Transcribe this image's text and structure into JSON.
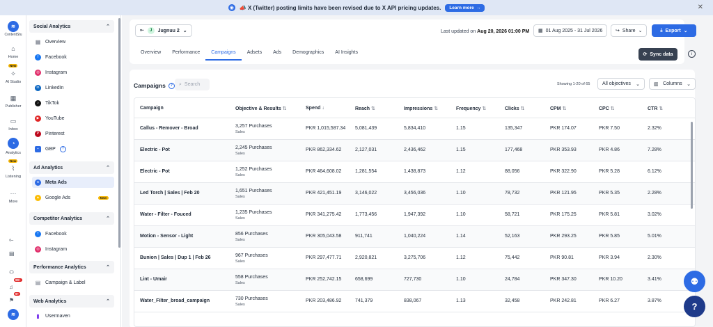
{
  "banner": {
    "message": "📣 X (Twitter) posting limits have been revised due to X API pricing updates.",
    "learn_more": "Learn more",
    "close": "✕"
  },
  "rail": {
    "brand": "ContentStu",
    "items": [
      {
        "label": "Home",
        "icon": "home-icon"
      },
      {
        "label": "AI Studio",
        "icon": "sparkle-icon",
        "tag": "New"
      },
      {
        "label": "Publisher",
        "icon": "calendar-icon"
      },
      {
        "label": "Inbox",
        "icon": "inbox-icon"
      },
      {
        "label": "Analytics",
        "icon": "analytics-icon"
      },
      {
        "label": "Listening",
        "icon": "listening-icon",
        "tag": "New"
      },
      {
        "label": "More",
        "icon": "more-icon"
      }
    ],
    "badges": [
      "99+",
      "9+"
    ]
  },
  "sidebar": {
    "social": {
      "title": "Social Analytics",
      "items": [
        "Overview",
        "Facebook",
        "Instagram",
        "LinkedIn",
        "TikTok",
        "YouTube",
        "Pinterest",
        "GBP"
      ]
    },
    "ad": {
      "title": "Ad Analytics",
      "items": [
        "Meta Ads",
        "Google Ads"
      ],
      "new_tag": "New"
    },
    "competitor": {
      "title": "Competitor Analytics",
      "items": [
        "Facebook",
        "Instagram"
      ]
    },
    "performance": {
      "title": "Performance Analytics",
      "items": [
        "Campaign & Label"
      ]
    },
    "web": {
      "title": "Web Analytics",
      "items": [
        "Usermaven"
      ]
    }
  },
  "header": {
    "account": "Jugnuu 2",
    "account_initial": "J",
    "updated_prefix": "Last updated on",
    "updated_value": "Aug 20, 2026 01:00 PM",
    "date_range": "01 Aug 2025 - 31 Jul 2026",
    "share": "Share",
    "export": "Export",
    "sync": "Sync data",
    "tabs": [
      "Overview",
      "Performance",
      "Campaigns",
      "Adsets",
      "Ads",
      "Demographics",
      "AI Insights"
    ]
  },
  "campaigns": {
    "title": "Campaigns",
    "search_placeholder": "Search",
    "showing": "Showing 1-20 of 65",
    "objective_filter": "All objectives",
    "columns_btn": "Columns",
    "columns": [
      "Campaign",
      "Objective & Results",
      "Spend",
      "Reach",
      "Impressions",
      "Frequency",
      "Clicks",
      "CPM",
      "CPC",
      "CTR"
    ],
    "rows": [
      {
        "campaign": "Callus - Remover - Broad",
        "result": "3,257 Purchases",
        "objective": "Sales",
        "spend": "PKR 1,015,587.34",
        "reach": "5,081,439",
        "impressions": "5,834,410",
        "frequency": "1.15",
        "clicks": "135,347",
        "cpm": "PKR 174.07",
        "cpc": "PKR 7.50",
        "ctr": "2.32%"
      },
      {
        "campaign": "Electric - Pot",
        "result": "2,245 Purchases",
        "objective": "Sales",
        "spend": "PKR 862,334.62",
        "reach": "2,127,031",
        "impressions": "2,436,462",
        "frequency": "1.15",
        "clicks": "177,468",
        "cpm": "PKR 353.93",
        "cpc": "PKR 4.86",
        "ctr": "7.28%"
      },
      {
        "campaign": "Electric - Pot",
        "result": "1,252 Purchases",
        "objective": "Sales",
        "spend": "PKR 464,608.02",
        "reach": "1,281,554",
        "impressions": "1,438,873",
        "frequency": "1.12",
        "clicks": "88,056",
        "cpm": "PKR 322.90",
        "cpc": "PKR 5.28",
        "ctr": "6.12%"
      },
      {
        "campaign": "Led Torch | Sales | Feb 20",
        "result": "1,651 Purchases",
        "objective": "Sales",
        "spend": "PKR 421,451.19",
        "reach": "3,146,022",
        "impressions": "3,456,036",
        "frequency": "1.10",
        "clicks": "78,732",
        "cpm": "PKR 121.95",
        "cpc": "PKR 5.35",
        "ctr": "2.28%"
      },
      {
        "campaign": "Water - Filter - Fouced",
        "result": "1,235 Purchases",
        "objective": "Sales",
        "spend": "PKR 341,275.42",
        "reach": "1,773,456",
        "impressions": "1,947,392",
        "frequency": "1.10",
        "clicks": "58,721",
        "cpm": "PKR 175.25",
        "cpc": "PKR 5.81",
        "ctr": "3.02%"
      },
      {
        "campaign": "Motion - Sensor - Light",
        "result": "856 Purchases",
        "objective": "Sales",
        "spend": "PKR 305,043.58",
        "reach": "911,741",
        "impressions": "1,040,224",
        "frequency": "1.14",
        "clicks": "52,163",
        "cpm": "PKR 293.25",
        "cpc": "PKR 5.85",
        "ctr": "5.01%"
      },
      {
        "campaign": "Bunion | Sales | Dup 1 | Feb 26",
        "result": "967 Purchases",
        "objective": "Sales",
        "spend": "PKR 297,477.71",
        "reach": "2,920,821",
        "impressions": "3,275,706",
        "frequency": "1.12",
        "clicks": "75,442",
        "cpm": "PKR 90.81",
        "cpc": "PKR 3.94",
        "ctr": "2.30%"
      },
      {
        "campaign": "Lint - Umair",
        "result": "558 Purchases",
        "objective": "Sales",
        "spend": "PKR 252,742.15",
        "reach": "658,699",
        "impressions": "727,730",
        "frequency": "1.10",
        "clicks": "24,784",
        "cpm": "PKR 347.30",
        "cpc": "PKR 10.20",
        "ctr": "3.41%"
      },
      {
        "campaign": "Water_Filter_broad_campaign",
        "result": "730 Purchases",
        "objective": "Sales",
        "spend": "PKR 203,486.92",
        "reach": "741,379",
        "impressions": "838,067",
        "frequency": "1.13",
        "clicks": "32,458",
        "cpm": "PKR 242.81",
        "cpc": "PKR 6.27",
        "ctr": "3.87%"
      }
    ]
  },
  "colors": {
    "accent": "#2d6be4",
    "dark": "#374151"
  }
}
